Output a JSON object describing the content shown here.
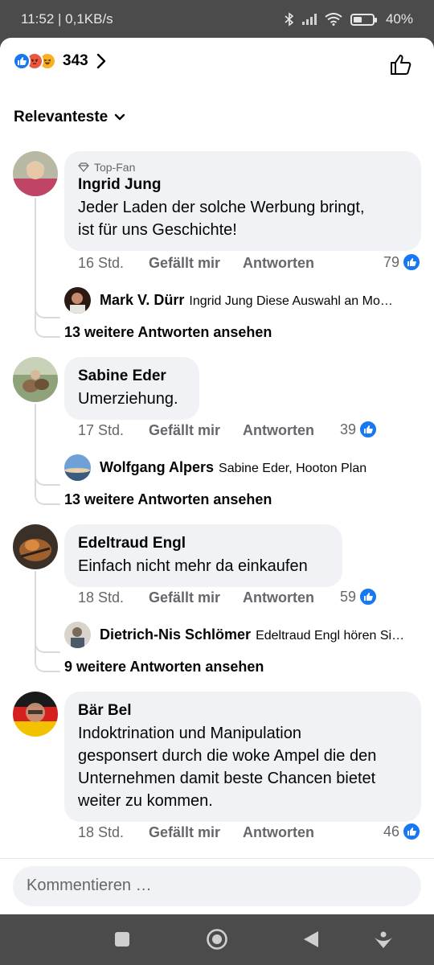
{
  "status": {
    "time_speed": "11:52 | 0,1KB/s",
    "battery": "40%"
  },
  "reactions": {
    "count": "343"
  },
  "sort": {
    "label": "Relevanteste"
  },
  "comments": [
    {
      "badge": "Top-Fan",
      "author": "Ingrid Jung",
      "lines": [
        "Jeder Laden der solche Werbung bringt,",
        "ist für uns Geschichte!"
      ],
      "time": "16 Std.",
      "like_action": "Gefällt mir",
      "reply_action": "Antworten",
      "likes": "79",
      "reply": {
        "author": "Mark V. Dürr",
        "text": "Ingrid Jung Diese Auswahl an Mo…"
      },
      "more": "13 weitere Antworten ansehen"
    },
    {
      "author": "Sabine Eder",
      "lines": [
        "Umerziehung."
      ],
      "time": "17 Std.",
      "like_action": "Gefällt mir",
      "reply_action": "Antworten",
      "likes": "39",
      "reply": {
        "author": "Wolfgang Alpers",
        "text": "Sabine Eder, Hooton Plan"
      },
      "more": "13 weitere Antworten ansehen"
    },
    {
      "author": "Edeltraud Engl",
      "lines": [
        "Einfach nicht mehr da einkaufen"
      ],
      "time": "18 Std.",
      "like_action": "Gefällt mir",
      "reply_action": "Antworten",
      "likes": "59",
      "reply": {
        "author": "Dietrich-Nis Schlömer",
        "text": "Edeltraud Engl hören Si…"
      },
      "more": "9 weitere Antworten ansehen"
    },
    {
      "author": "Bär Bel",
      "lines": [
        "Indoktrination und Manipulation",
        "gesponsert durch die woke Ampel die den",
        "Unternehmen damit beste Chancen bietet",
        "weiter zu kommen."
      ],
      "time": "18 Std.",
      "like_action": "Gefällt mir",
      "reply_action": "Antworten",
      "likes": "46"
    }
  ],
  "composer": {
    "placeholder": "Kommentieren …"
  },
  "colors": {
    "accent": "#1877f2",
    "bubble": "#f0f2f5",
    "muted": "#65676b"
  },
  "icons": [
    "like-reaction-icon",
    "angry-reaction-icon",
    "haha-reaction-icon",
    "chevron-right-icon",
    "like-outline-icon",
    "chevron-down-icon",
    "diamond-icon",
    "square-nav-icon",
    "home-circle-nav-icon",
    "back-nav-icon",
    "assistant-nav-icon"
  ]
}
